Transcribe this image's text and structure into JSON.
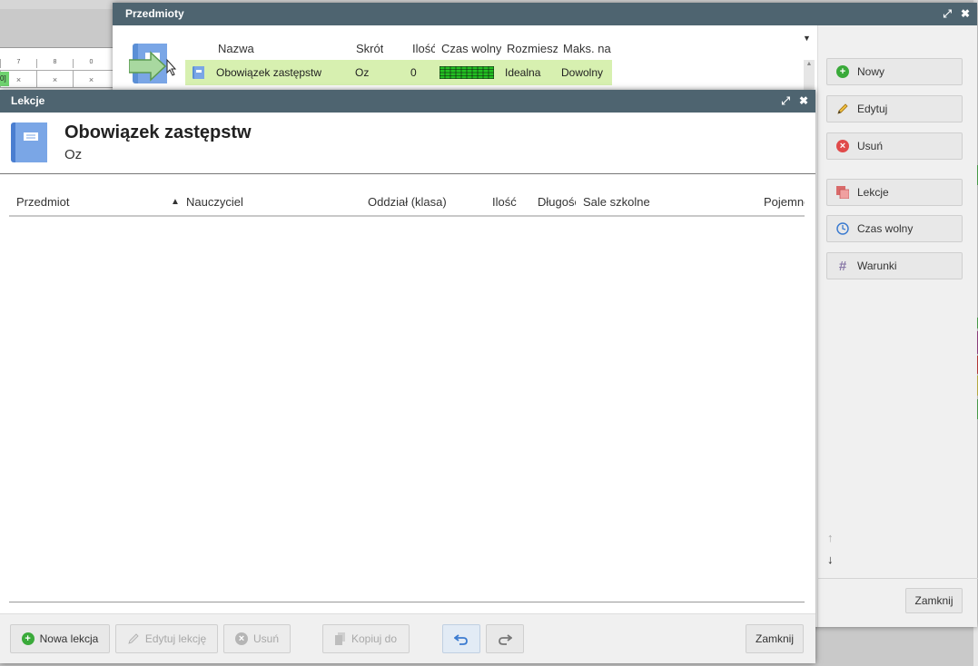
{
  "przedmioty": {
    "title": "Przedmioty",
    "columns": [
      "Nazwa",
      "Skrót",
      "Ilość",
      "Czas wolny",
      "Rozmieszczenie",
      "Maks. na"
    ],
    "row": {
      "nazwa": "Obowiązek zastępstw",
      "skrot": "Oz",
      "ilosc": "0",
      "rozmieszczenie": "Idealna",
      "maks": "Dowolny"
    },
    "side_buttons": {
      "nowy": "Nowy",
      "edytuj": "Edytuj",
      "usun": "Usuń",
      "lekcje": "Lekcje",
      "czas_wolny": "Czas wolny",
      "warunki": "Warunki"
    },
    "close": "Zamknij"
  },
  "lekcje": {
    "title": "Lekcje",
    "subject_name": "Obowiązek zastępstw",
    "subject_short": "Oz",
    "columns": {
      "przedmiot": "Przedmiot",
      "sort_indicator": "▲",
      "nauczyciel": "Nauczyciel",
      "oddzial": "Oddział (klasa)",
      "ilosc": "Ilość",
      "dlugosc": "Długość",
      "sale": "Sale szkolne",
      "pojemnosc": "Pojemność"
    },
    "footer": {
      "nowa_lekcja": "Nowa lekcja",
      "edytuj_lekcje": "Edytuj lekcję",
      "usun": "Usuń",
      "kopiuj_do": "Kopiuj do",
      "zamknij": "Zamknij"
    }
  },
  "background_grid": {
    "headers": [
      "7",
      "8",
      "0"
    ],
    "cells": [
      "×",
      "×",
      "×"
    ],
    "green_cell": "0]"
  },
  "colors": {
    "titlebar": "#4e6470",
    "selected_row": "#d7f0b0",
    "green_icon": "#3aaa3a",
    "red_icon": "#e04a4a",
    "timeslots": "#22c022"
  }
}
